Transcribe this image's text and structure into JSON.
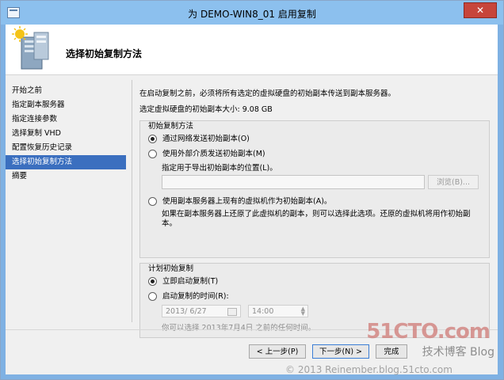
{
  "window": {
    "title": "为 DEMO-WIN8_01 启用复制",
    "close_glyph": "✕"
  },
  "header": {
    "page_title": "选择初始复制方法",
    "icon": "server-replication-icon"
  },
  "nav": {
    "items": [
      {
        "label": "开始之前"
      },
      {
        "label": "指定副本服务器"
      },
      {
        "label": "指定连接参数"
      },
      {
        "label": "选择复制 VHD"
      },
      {
        "label": "配置恢复历史记录"
      },
      {
        "label": "选择初始复制方法",
        "selected": true
      },
      {
        "label": "摘要"
      }
    ]
  },
  "content": {
    "description": "在启动复制之前，必须将所有选定的虚拟硬盘的初始副本传送到副本服务器。",
    "size_text": "选定虚拟硬盘的初始副本大小: 9.08 GB",
    "method_group": {
      "label": "初始复制方法",
      "option_network": "通过网络发送初始副本(O)",
      "option_external": "使用外部介质发送初始副本(M)",
      "export_location_label": "指定用于导出初始副本的位置(L)。",
      "export_location_value": "",
      "browse_button": "浏览(B)...",
      "option_existing": "使用副本服务器上现有的虚拟机作为初始副本(A)。",
      "existing_note": "如果在副本服务器上还原了此虚拟机的副本，则可以选择此选项。还原的虚拟机将用作初始副本。",
      "selected": "network"
    },
    "schedule_group": {
      "label": "计划初始复制",
      "option_now": "立即启动复制(T)",
      "option_later": "启动复制的时间(R):",
      "date_value": "2013/ 6/27",
      "time_value": "14:00",
      "hint": "你可以选择 2013年7月4日 之前的任何时间。",
      "selected": "now"
    }
  },
  "footer": {
    "prev_button": "< 上一步(P)",
    "next_button": "下一步(N) >",
    "finish_button": "完成"
  },
  "watermark": {
    "site": "51CTO.com",
    "sub": "技术博客  Blog",
    "copyright": "© 2013 Reinember.blog.51cto.com"
  },
  "colors": {
    "titlebar": "#8cc0ee",
    "nav_selected": "#3b6fbf",
    "close_button": "#c7453b"
  }
}
